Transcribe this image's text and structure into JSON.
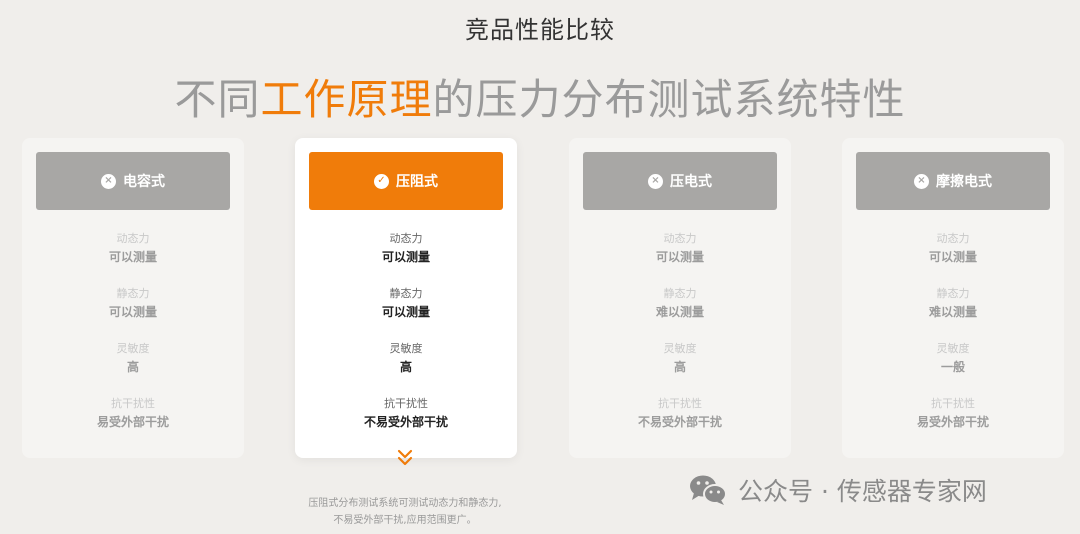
{
  "eyebrow": "竞品性能比较",
  "headline": {
    "pre": "不同",
    "highlight": "工作原理",
    "post": "的压力分布测试系统特性"
  },
  "labels": {
    "dynamic": "动态力",
    "static": "静态力",
    "sensitivity": "灵敏度",
    "interference": "抗干扰性"
  },
  "cards": [
    {
      "title": "电容式",
      "icon": "×",
      "dynamic": "可以测量",
      "static": "可以测量",
      "sensitivity": "高",
      "interference": "易受外部干扰"
    },
    {
      "title": "压阻式",
      "icon": "✓",
      "dynamic": "可以测量",
      "static": "可以测量",
      "sensitivity": "高",
      "interference": "不易受外部干扰"
    },
    {
      "title": "压电式",
      "icon": "×",
      "dynamic": "可以测量",
      "static": "难以测量",
      "sensitivity": "高",
      "interference": "不易受外部干扰"
    },
    {
      "title": "摩擦电式",
      "icon": "×",
      "dynamic": "可以测量",
      "static": "难以测量",
      "sensitivity": "一般",
      "interference": "易受外部干扰"
    }
  ],
  "note": {
    "line1": "压阻式分布测试系统可测试动态力和静态力,",
    "line2": "不易受外部干扰,应用范围更广。"
  },
  "watermark": "公众号 · 传感器专家网",
  "colors": {
    "accent": "#f07c0a",
    "inactive_header": "#a8a7a5",
    "background": "#f0eeeb"
  },
  "icons": {
    "inactive": "close-circle-icon",
    "active": "check-circle-icon",
    "more": "double-chevron-down-icon",
    "brand": "wechat-icon"
  }
}
